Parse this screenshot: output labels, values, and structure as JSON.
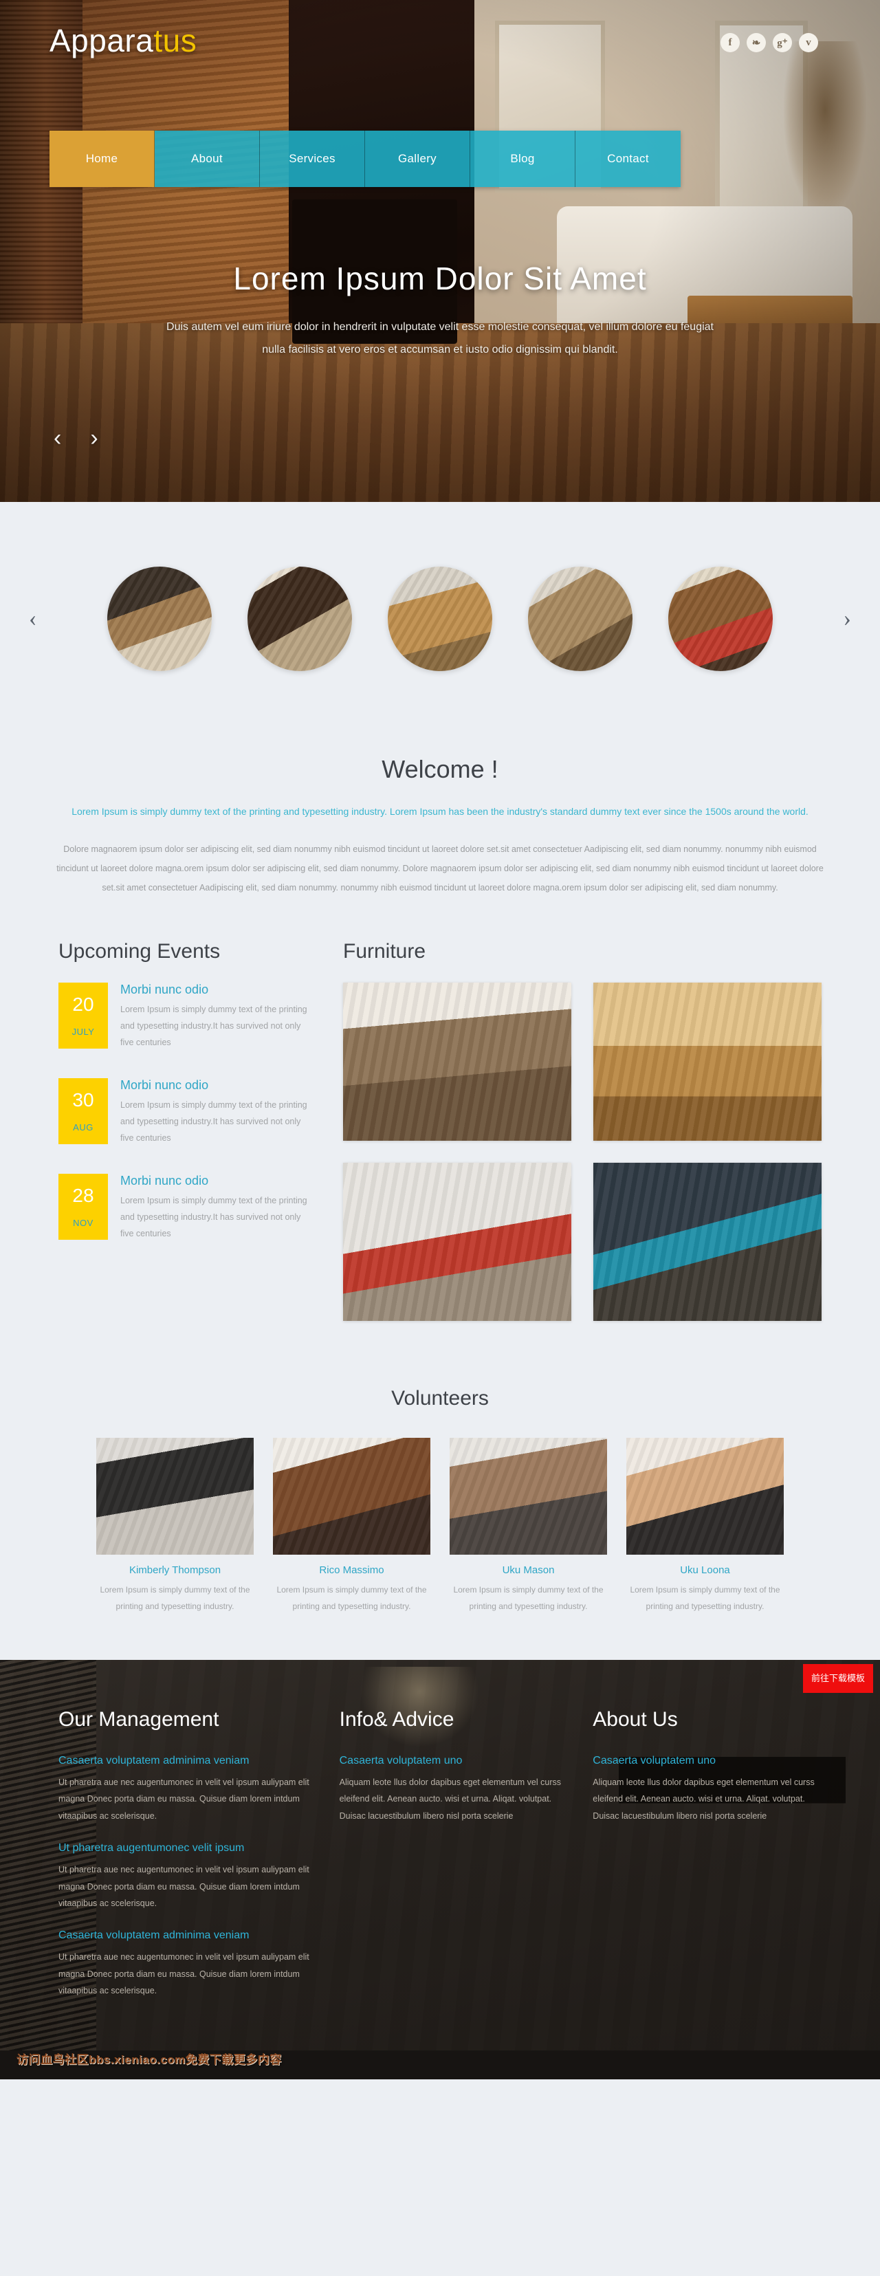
{
  "brand": {
    "part1": "Appara",
    "part2": "tus"
  },
  "social": [
    {
      "name": "facebook-icon",
      "glyph": "f"
    },
    {
      "name": "twitter-icon",
      "glyph": "❧"
    },
    {
      "name": "googleplus-icon",
      "glyph": "g⁺"
    },
    {
      "name": "vimeo-icon",
      "glyph": "v"
    }
  ],
  "nav": {
    "items": [
      {
        "label": "Home",
        "active": true
      },
      {
        "label": "About",
        "active": false
      },
      {
        "label": "Services",
        "active": false
      },
      {
        "label": "Gallery",
        "active": false
      },
      {
        "label": "Blog",
        "active": false
      },
      {
        "label": "Contact",
        "active": false
      }
    ]
  },
  "hero": {
    "title": "Lorem Ipsum Dolor Sit Amet",
    "text": "Duis autem vel eum iriure dolor in hendrerit in vulputate velit esse molestie consequat, vel illum dolore eu feugiat nulla facilisis at vero eros et accumsan et iusto odio dignissim qui blandit.",
    "prev_arrow": "‹",
    "next_arrow": "›"
  },
  "carousel": {
    "prev_arrow": "‹",
    "next_arrow": "›",
    "thumbs": [
      {
        "name": "thumb-kitchen-dark"
      },
      {
        "name": "thumb-dining-chandelier"
      },
      {
        "name": "thumb-kitchen-pendant"
      },
      {
        "name": "thumb-living-room"
      },
      {
        "name": "thumb-bedroom"
      }
    ]
  },
  "welcome": {
    "title": "Welcome !",
    "lead": "Lorem Ipsum is simply dummy text of the printing and typesetting industry. Lorem Ipsum has been the industry's standard dummy text ever since the 1500s around the world.",
    "body": "Dolore magnaorem ipsum dolor ser adipiscing elit, sed diam nonummy nibh euismod tincidunt ut laoreet dolore set.sit amet consectetuer Aadipiscing elit, sed diam nonummy. nonummy nibh euismod tincidunt ut laoreet dolore magna.orem ipsum dolor ser adipiscing elit, sed diam nonummy. Dolore magnaorem ipsum dolor ser adipiscing elit, sed diam nonummy nibh euismod tincidunt ut laoreet dolore set.sit amet consectetuer Aadipiscing elit, sed diam nonummy. nonummy nibh euismod tincidunt ut laoreet dolore magna.orem ipsum dolor ser adipiscing elit, sed diam nonummy."
  },
  "events": {
    "title": "Upcoming Events",
    "items": [
      {
        "day": "20",
        "month": "JULY",
        "title": "Morbi nunc odio",
        "text": "Lorem Ipsum is simply dummy text of the printing and typesetting industry.It has survived not only five centuries"
      },
      {
        "day": "30",
        "month": "AUG",
        "title": "Morbi nunc odio",
        "text": "Lorem Ipsum is simply dummy text of the printing and typesetting industry.It has survived not only five centuries"
      },
      {
        "day": "28",
        "month": "NOV",
        "title": "Morbi nunc odio",
        "text": "Lorem Ipsum is simply dummy text of the printing and typesetting industry.It has survived not only five centuries"
      }
    ]
  },
  "furniture": {
    "title": "Furniture",
    "items": [
      {
        "name": "furniture-dining-room"
      },
      {
        "name": "furniture-wood-bathroom"
      },
      {
        "name": "furniture-red-sofa"
      },
      {
        "name": "furniture-lounge-tv"
      }
    ]
  },
  "volunteers": {
    "title": "Volunteers",
    "items": [
      {
        "name": "Kimberly Thompson",
        "text": "Lorem Ipsum is simply dummy text of the printing and typesetting industry."
      },
      {
        "name": "Rico Massimo",
        "text": "Lorem Ipsum is simply dummy text of the printing and typesetting industry."
      },
      {
        "name": "Uku Mason",
        "text": "Lorem Ipsum is simply dummy text of the printing and typesetting industry."
      },
      {
        "name": "Uku Loona",
        "text": "Lorem Ipsum is simply dummy text of the printing and typesetting industry."
      }
    ]
  },
  "footer": {
    "columns": [
      {
        "title": "Our Management",
        "blocks": [
          {
            "heading": "Casaerta voluptatem adminima veniam",
            "text": "Ut pharetra aue nec augentumonec in velit vel ipsum auliypam elit magna Donec porta diam eu massa. Quisue diam lorem intdum vitaapibus ac scelerisque."
          },
          {
            "heading": "Ut pharetra augentumonec velit ipsum",
            "text": "Ut pharetra aue nec augentumonec in velit vel ipsum auliypam elit magna Donec porta diam eu massa. Quisue diam lorem intdum vitaapibus ac scelerisque."
          },
          {
            "heading": "Casaerta voluptatem adminima veniam",
            "text": "Ut pharetra aue nec augentumonec in velit vel ipsum auliypam elit magna Donec porta diam eu massa. Quisue diam lorem intdum vitaapibus ac scelerisque."
          }
        ]
      },
      {
        "title": "Info& Advice",
        "blocks": [
          {
            "heading": "Casaerta voluptatem uno",
            "text": "Aliquam leote llus dolor dapibus eget elementum vel curss eleifend elit. Aenean aucto. wisi et urna. Aliqat. volutpat. Duisac lacuestibulum libero nisl porta scelerie"
          }
        ]
      },
      {
        "title": "About Us",
        "blocks": [
          {
            "heading": "Casaerta voluptatem uno",
            "text": "Aliquam leote llus dolor dapibus eget elementum vel curss eleifend elit. Aenean aucto. wisi et urna. Aliqat. volutpat. Duisac lacuestibulum libero nisl porta scelerie"
          }
        ]
      }
    ]
  },
  "overlay": {
    "watermark": "访问血鸟社区bbs.xieniao.com免费下载更多内容",
    "download_button": "前往下载模板"
  },
  "colors": {
    "accent_cyan": "#2fa6c6",
    "accent_gold": "#dba135",
    "event_yellow": "#fdd100",
    "page_bg": "#eceff3",
    "download_red": "#ef0e0e"
  }
}
